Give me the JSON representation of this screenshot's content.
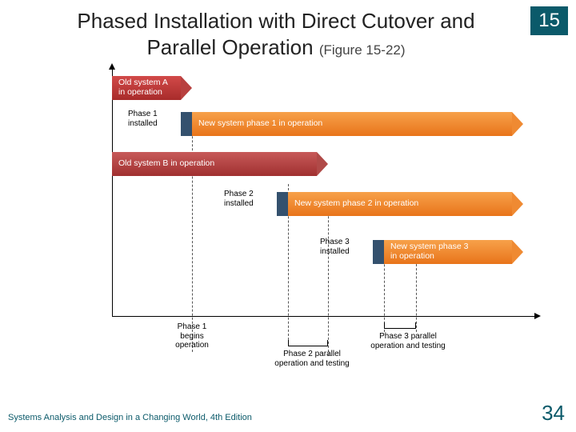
{
  "header": {
    "title_line1": "Phased Installation with Direct Cutover and",
    "title_line2": "Parallel Operation",
    "figure_ref": "(Figure 15-22)",
    "chapter": "15"
  },
  "bars": {
    "oldA": "Old system A\nin operation",
    "oldB": "Old system B in operation",
    "newP1": "New system phase 1 in operation",
    "newP2": "New system phase 2 in operation",
    "newP3": "New system phase 3\nin operation"
  },
  "callouts": {
    "phase1_installed": "Phase 1\ninstalled",
    "phase2_installed": "Phase 2\ninstalled",
    "phase3_installed": "Phase 3\ninstalled"
  },
  "annotations": {
    "phase1_begins": "Phase 1\nbegins\noperation",
    "phase2_parallel": "Phase 2 parallel\noperation and testing",
    "phase3_parallel": "Phase 3 parallel\noperation and testing"
  },
  "footer": {
    "source": "Systems Analysis and Design in a Changing World, 4th Edition",
    "page": "34"
  }
}
